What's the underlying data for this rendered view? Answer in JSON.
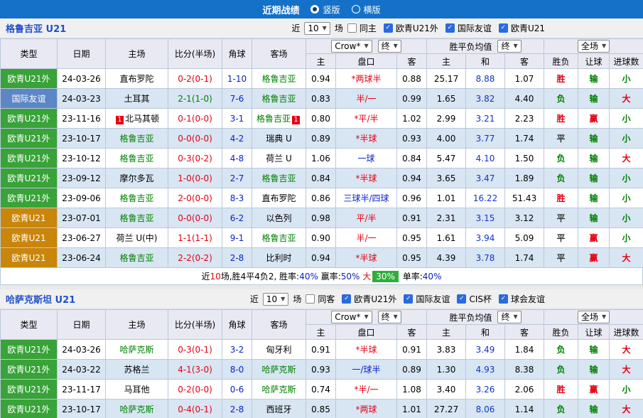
{
  "topbar": {
    "title": "近期战绩",
    "vertical_label": "竖版",
    "horizontal_label": "横版"
  },
  "columns": {
    "type": "类型",
    "date": "日期",
    "home": "主场",
    "score": "比分(半场)",
    "corner": "角球",
    "away": "客场",
    "oh": "主",
    "pk": "盘口",
    "oa": "客",
    "w": "主",
    "d": "和",
    "l": "客",
    "res": "胜负",
    "hr": "让球",
    "g": "进球数",
    "bookmaker": "Crow*",
    "final": "终",
    "avg_label": "胜平负均值",
    "full": "全场"
  },
  "sections": [
    {
      "team": "格鲁吉亚 U21",
      "near": "近",
      "count": "10",
      "unit": "场",
      "filters": [
        {
          "label": "同主",
          "checked": false
        },
        {
          "label": "欧青U21外",
          "checked": true
        },
        {
          "label": "国际友谊",
          "checked": true
        },
        {
          "label": "欧青U21",
          "checked": true
        }
      ],
      "rows": [
        {
          "type": {
            "t": "欧青U21外",
            "c": "tag-green"
          },
          "date": "24-03-26",
          "home": "直布罗陀",
          "score": {
            "t": "0-2(0-1)",
            "c": "t-red"
          },
          "corner": "1-10",
          "away": {
            "t": "格鲁吉亚",
            "c": "t-green"
          },
          "oh": "0.94",
          "pk": {
            "t": "*两球半",
            "c": "t-red"
          },
          "oa": "0.88",
          "w": "25.17",
          "d": "8.88",
          "l": "1.07",
          "res": {
            "t": "胜",
            "c": "t-red"
          },
          "hr": {
            "t": "输",
            "c": "t-green"
          },
          "g": {
            "t": "小",
            "c": "t-green"
          }
        },
        {
          "type": {
            "t": "国际友谊",
            "c": "tag-blue"
          },
          "date": "24-03-23",
          "home": "土耳其",
          "score": {
            "t": "2-1(1-0)",
            "c": "t-green"
          },
          "corner": "7-6",
          "away": {
            "t": "格鲁吉亚",
            "c": "t-green"
          },
          "oh": "0.83",
          "pk": {
            "t": "半/一",
            "c": "t-red"
          },
          "oa": "0.99",
          "w": "1.65",
          "d": "3.82",
          "l": "4.40",
          "res": {
            "t": "负",
            "c": "t-green"
          },
          "hr": {
            "t": "输",
            "c": "t-green"
          },
          "g": {
            "t": "大",
            "c": "t-red"
          }
        },
        {
          "type": {
            "t": "欧青U21外",
            "c": "tag-green"
          },
          "date": "23-11-16",
          "home": {
            "t": "北马其顿",
            "b1": "1"
          },
          "score": {
            "t": "0-1(0-0)",
            "c": "t-red"
          },
          "corner": "3-1",
          "away": {
            "t": "格鲁吉亚",
            "c": "t-green",
            "b2": "1"
          },
          "oh": "0.80",
          "pk": {
            "t": "*平/半",
            "c": "t-red"
          },
          "oa": "1.02",
          "w": "2.99",
          "d": "3.21",
          "l": "2.23",
          "res": {
            "t": "胜",
            "c": "t-red"
          },
          "hr": {
            "t": "赢",
            "c": "t-red"
          },
          "g": {
            "t": "小",
            "c": "t-green"
          }
        },
        {
          "type": {
            "t": "欧青U21外",
            "c": "tag-green"
          },
          "date": "23-10-17",
          "home": {
            "t": "格鲁吉亚",
            "c": "t-green"
          },
          "score": {
            "t": "0-0(0-0)",
            "c": "t-red"
          },
          "corner": "4-2",
          "away": "瑞典 U",
          "oh": "0.89",
          "pk": {
            "t": "*半球",
            "c": "t-red"
          },
          "oa": "0.93",
          "w": "4.00",
          "d": "3.77",
          "l": "1.74",
          "res": {
            "t": "平",
            "c": "t-dark"
          },
          "hr": {
            "t": "输",
            "c": "t-green"
          },
          "g": {
            "t": "小",
            "c": "t-green"
          }
        },
        {
          "type": {
            "t": "欧青U21外",
            "c": "tag-green"
          },
          "date": "23-10-12",
          "home": {
            "t": "格鲁吉亚",
            "c": "t-green"
          },
          "score": {
            "t": "0-3(0-2)",
            "c": "t-red"
          },
          "corner": "4-8",
          "away": "荷兰 U",
          "oh": "1.06",
          "pk": {
            "t": "一球",
            "c": "t-blue"
          },
          "oa": "0.84",
          "w": "5.47",
          "d": "4.10",
          "l": "1.50",
          "res": {
            "t": "负",
            "c": "t-green"
          },
          "hr": {
            "t": "输",
            "c": "t-green"
          },
          "g": {
            "t": "大",
            "c": "t-red"
          }
        },
        {
          "type": {
            "t": "欧青U21外",
            "c": "tag-green"
          },
          "date": "23-09-12",
          "home": "摩尔多瓦",
          "score": {
            "t": "1-0(0-0)",
            "c": "t-red"
          },
          "corner": "2-7",
          "away": {
            "t": "格鲁吉亚",
            "c": "t-green"
          },
          "oh": "0.84",
          "pk": {
            "t": "*半球",
            "c": "t-red"
          },
          "oa": "0.94",
          "w": "3.65",
          "d": "3.47",
          "l": "1.89",
          "res": {
            "t": "负",
            "c": "t-green"
          },
          "hr": {
            "t": "输",
            "c": "t-green"
          },
          "g": {
            "t": "小",
            "c": "t-green"
          }
        },
        {
          "type": {
            "t": "欧青U21外",
            "c": "tag-green"
          },
          "date": "23-09-06",
          "home": {
            "t": "格鲁吉亚",
            "c": "t-green"
          },
          "score": {
            "t": "2-0(0-0)",
            "c": "t-red"
          },
          "corner": "8-3",
          "away": "直布罗陀",
          "oh": "0.86",
          "pk": {
            "t": "三球半/四球",
            "c": "t-blue"
          },
          "oa": "0.96",
          "w": "1.01",
          "d": "16.22",
          "l": "51.43",
          "res": {
            "t": "胜",
            "c": "t-red"
          },
          "hr": {
            "t": "输",
            "c": "t-green"
          },
          "g": {
            "t": "小",
            "c": "t-green"
          }
        },
        {
          "type": {
            "t": "欧青U21",
            "c": "tag-orange"
          },
          "date": "23-07-01",
          "home": {
            "t": "格鲁吉亚",
            "c": "t-green"
          },
          "score": {
            "t": "0-0(0-0)",
            "c": "t-red"
          },
          "corner": "6-2",
          "away": "以色列",
          "oh": "0.98",
          "pk": {
            "t": "平/半",
            "c": "t-red"
          },
          "oa": "0.91",
          "w": "2.31",
          "d": "3.15",
          "l": "3.12",
          "res": {
            "t": "平",
            "c": "t-dark"
          },
          "hr": {
            "t": "输",
            "c": "t-green"
          },
          "g": {
            "t": "小",
            "c": "t-green"
          }
        },
        {
          "type": {
            "t": "欧青U21",
            "c": "tag-orange"
          },
          "date": "23-06-27",
          "home": "荷兰 U(中)",
          "score": {
            "t": "1-1(1-1)",
            "c": "t-red"
          },
          "corner": "9-1",
          "away": {
            "t": "格鲁吉亚",
            "c": "t-green"
          },
          "oh": "0.90",
          "pk": {
            "t": "半/一",
            "c": "t-red"
          },
          "oa": "0.95",
          "w": "1.61",
          "d": "3.94",
          "l": "5.09",
          "res": {
            "t": "平",
            "c": "t-dark"
          },
          "hr": {
            "t": "赢",
            "c": "t-red"
          },
          "g": {
            "t": "小",
            "c": "t-green"
          }
        },
        {
          "type": {
            "t": "欧青U21",
            "c": "tag-orange"
          },
          "date": "23-06-24",
          "home": {
            "t": "格鲁吉亚",
            "c": "t-green"
          },
          "score": {
            "t": "2-2(0-2)",
            "c": "t-red"
          },
          "corner": "2-8",
          "away": "比利时",
          "oh": "0.94",
          "pk": {
            "t": "*半球",
            "c": "t-red"
          },
          "oa": "0.95",
          "w": "4.39",
          "d": "3.78",
          "l": "1.74",
          "res": {
            "t": "平",
            "c": "t-dark"
          },
          "hr": {
            "t": "赢",
            "c": "t-red"
          },
          "g": {
            "t": "大",
            "c": "t-red"
          }
        }
      ],
      "summary": [
        {
          "t": "近"
        },
        {
          "t": "10",
          "c": "t-red"
        },
        {
          "t": "场,胜4平4负2, "
        },
        {
          "t": "胜率:"
        },
        {
          "t": "40%",
          "c": "t-blue"
        },
        {
          "t": " 赢率:"
        },
        {
          "t": "50%",
          "c": "t-blue"
        },
        {
          "t": " "
        },
        {
          "t": "大",
          "c": "t-red"
        },
        {
          "t": "30%",
          "c": "badge-green"
        },
        {
          "t": " 单率:"
        },
        {
          "t": "40%",
          "c": "t-blue"
        }
      ]
    },
    {
      "team": "哈萨克斯坦 U21",
      "near": "近",
      "count": "10",
      "unit": "场",
      "filters": [
        {
          "label": "同客",
          "checked": false
        },
        {
          "label": "欧青U21外",
          "checked": true
        },
        {
          "label": "国际友谊",
          "checked": true
        },
        {
          "label": "CIS杯",
          "checked": true
        },
        {
          "label": "球会友谊",
          "checked": true
        }
      ],
      "rows": [
        {
          "type": {
            "t": "欧青U21外",
            "c": "tag-green"
          },
          "date": "24-03-26",
          "home": {
            "t": "哈萨克斯",
            "c": "t-green"
          },
          "score": {
            "t": "0-3(0-1)",
            "c": "t-red"
          },
          "corner": "3-2",
          "away": "匈牙利",
          "oh": "0.91",
          "pk": {
            "t": "*半球",
            "c": "t-red"
          },
          "oa": "0.91",
          "w": "3.83",
          "d": "3.49",
          "l": "1.84",
          "res": {
            "t": "负",
            "c": "t-green"
          },
          "hr": {
            "t": "输",
            "c": "t-green"
          },
          "g": {
            "t": "大",
            "c": "t-red"
          }
        },
        {
          "type": {
            "t": "欧青U21外",
            "c": "tag-green"
          },
          "date": "24-03-22",
          "home": "苏格兰",
          "score": {
            "t": "4-1(3-0)",
            "c": "t-red"
          },
          "corner": "8-0",
          "away": {
            "t": "哈萨克斯",
            "c": "t-green"
          },
          "oh": "0.93",
          "pk": {
            "t": "一/球半",
            "c": "t-blue"
          },
          "oa": "0.89",
          "w": "1.30",
          "d": "4.93",
          "l": "8.38",
          "res": {
            "t": "负",
            "c": "t-green"
          },
          "hr": {
            "t": "输",
            "c": "t-green"
          },
          "g": {
            "t": "大",
            "c": "t-red"
          }
        },
        {
          "type": {
            "t": "欧青U21外",
            "c": "tag-green"
          },
          "date": "23-11-17",
          "home": "马耳他",
          "score": {
            "t": "0-2(0-0)",
            "c": "t-red"
          },
          "corner": "0-6",
          "away": {
            "t": "哈萨克斯",
            "c": "t-green"
          },
          "oh": "0.74",
          "pk": {
            "t": "*半/一",
            "c": "t-red"
          },
          "oa": "1.08",
          "w": "3.40",
          "d": "3.26",
          "l": "2.06",
          "res": {
            "t": "胜",
            "c": "t-red"
          },
          "hr": {
            "t": "赢",
            "c": "t-red"
          },
          "g": {
            "t": "小",
            "c": "t-green"
          }
        },
        {
          "type": {
            "t": "欧青U21外",
            "c": "tag-green"
          },
          "date": "23-10-17",
          "home": {
            "t": "哈萨克斯",
            "c": "t-green"
          },
          "score": {
            "t": "0-4(0-1)",
            "c": "t-red"
          },
          "corner": "2-8",
          "away": "西班牙",
          "oh": "0.85",
          "pk": {
            "t": "*两球",
            "c": "t-red"
          },
          "oa": "1.01",
          "w": "27.27",
          "d": "8.06",
          "l": "1.14",
          "res": {
            "t": "负",
            "c": "t-green"
          },
          "hr": {
            "t": "输",
            "c": "t-green"
          },
          "g": {
            "t": "大",
            "c": "t-red"
          }
        }
      ]
    }
  ]
}
